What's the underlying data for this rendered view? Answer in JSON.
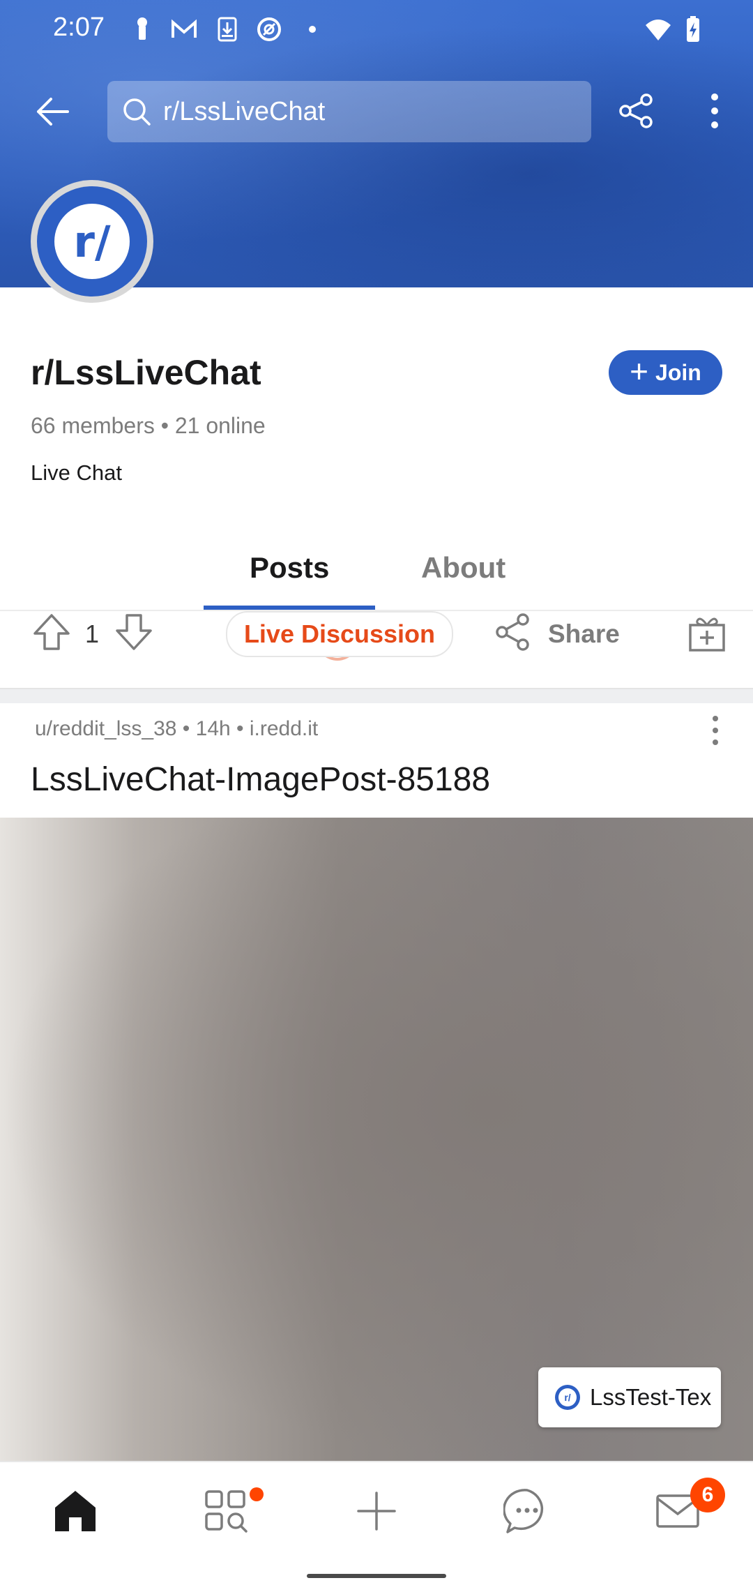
{
  "status_bar": {
    "time": "2:07"
  },
  "header": {
    "search_text": "r/LssLiveChat"
  },
  "community": {
    "avatar_text": "r/",
    "name": "r/LssLiveChat",
    "join_label": "Join",
    "members": "66 members • 21 online",
    "description": "Live Chat"
  },
  "tabs": [
    {
      "label": "Posts",
      "active": true
    },
    {
      "label": "About",
      "active": false
    }
  ],
  "action_row": {
    "vote_count": "1",
    "live_label": "Live Discussion",
    "share_label": "Share"
  },
  "post": {
    "meta": "u/reddit_lss_38 • 14h • i.redd.it",
    "title": "LssLiveChat-ImagePost-85188"
  },
  "chat_chip": {
    "avatar_text": "r/",
    "text": "LssTest-Tex"
  },
  "bottom_nav": {
    "inbox_badge": "6"
  },
  "colors": {
    "brand_blue": "#2d5fc4",
    "accent_orange": "#ff4500",
    "live_red": "#e64a19"
  },
  "icons": [
    "back-arrow-icon",
    "search-icon",
    "share-icon",
    "more-vert-icon",
    "plus-icon",
    "upvote-icon",
    "downvote-icon",
    "gift-icon",
    "home-icon",
    "discover-icon",
    "create-icon",
    "chat-icon",
    "inbox-icon"
  ]
}
